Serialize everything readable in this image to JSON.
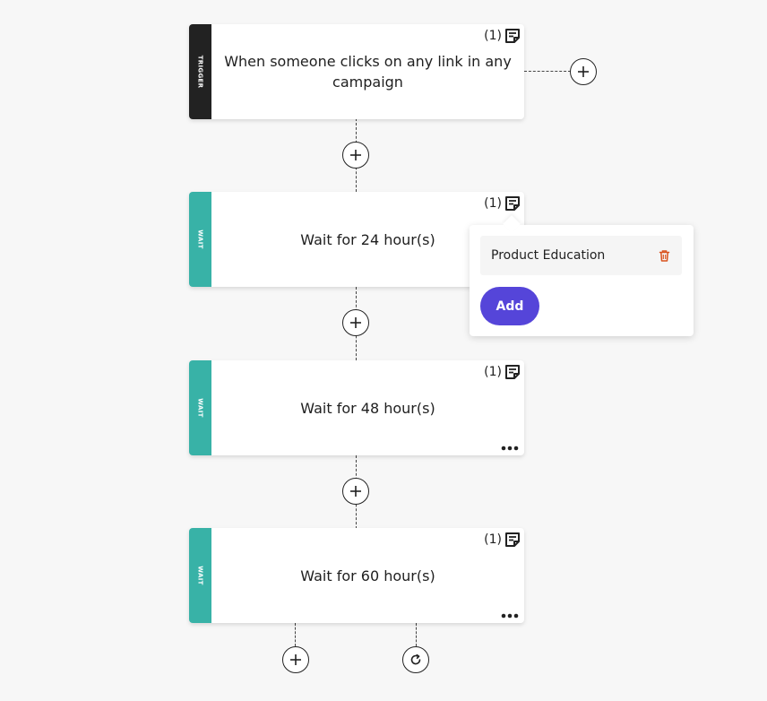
{
  "colors": {
    "trigger_strip": "#222222",
    "wait_strip": "#38b2a7",
    "add_button": "#5545d9",
    "trash": "#d9531e"
  },
  "trigger": {
    "strip_label": "TRIGGER",
    "text": "When someone clicks on any link in any campaign",
    "note_count": "(1)"
  },
  "waits": [
    {
      "strip_label": "WAIT",
      "text": "Wait for 24 hour(s)",
      "note_count": "(1)"
    },
    {
      "strip_label": "WAIT",
      "text": "Wait for 48 hour(s)",
      "note_count": "(1)"
    },
    {
      "strip_label": "WAIT",
      "text": "Wait for 60 hour(s)",
      "note_count": "(1)"
    }
  ],
  "notes_popover": {
    "note_label": "Product Education",
    "add_label": "Add"
  },
  "icons": {
    "note": "note-icon",
    "plus": "plus-icon",
    "more": "more-horizontal-icon",
    "trash": "trash-icon",
    "refresh": "refresh-icon"
  }
}
